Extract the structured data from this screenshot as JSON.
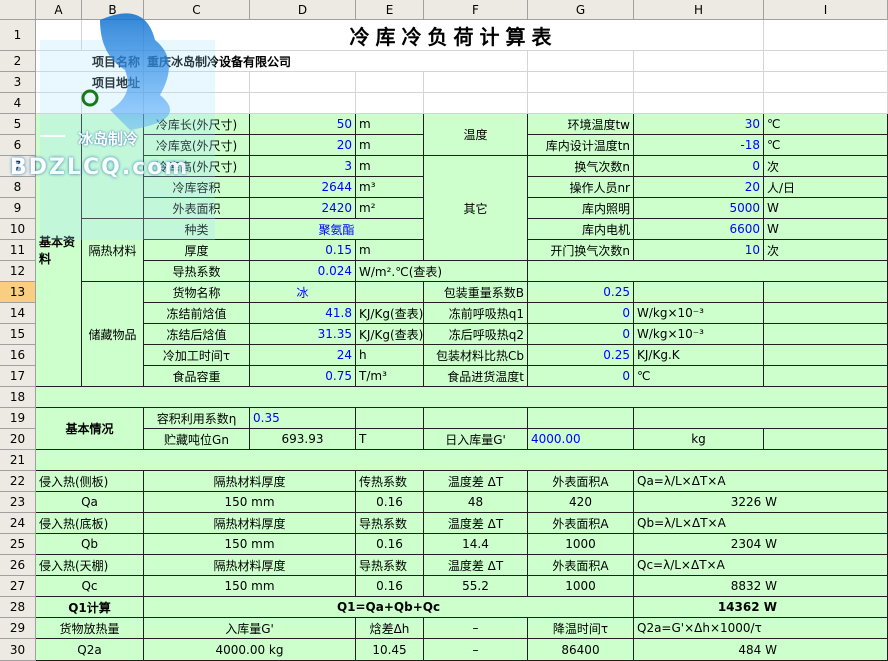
{
  "columns": [
    "A",
    "B",
    "C",
    "D",
    "E",
    "F",
    "G",
    "H",
    "I"
  ],
  "rows": [
    "1",
    "2",
    "3",
    "4",
    "5",
    "6",
    "7",
    "8",
    "9",
    "10",
    "11",
    "12",
    "13",
    "14",
    "15",
    "16",
    "17",
    "18",
    "19",
    "20",
    "21",
    "22",
    "23",
    "24",
    "25",
    "26",
    "27",
    "28",
    "29",
    "30"
  ],
  "selected_row": "13",
  "watermark": {
    "brand_cn": "冰岛制冷",
    "brand_url": "BDZLCQ.com"
  },
  "title": "冷库冷负荷计算表",
  "r2": {
    "label": "项目名称",
    "company": "重庆冰岛制冷设备有限公司"
  },
  "r3": {
    "label": "项目地址"
  },
  "basic_label": "基本资料",
  "insul_label": "隔热材料",
  "storage_label": "储藏物品",
  "left": [
    {
      "row": "5",
      "label": "冷库长(外尺寸)",
      "value": "50",
      "unit": "m"
    },
    {
      "row": "6",
      "label": "冷库宽(外尺寸)",
      "value": "20",
      "unit": "m"
    },
    {
      "row": "7",
      "label": "冷库高(外尺寸)",
      "value": "3",
      "unit": "m"
    },
    {
      "row": "8",
      "label": "冷库容积",
      "value": "2644",
      "unit": "m³"
    },
    {
      "row": "9",
      "label": "外表面积",
      "value": "2420",
      "unit": "m²"
    }
  ],
  "r10": {
    "label": "种类",
    "value": "聚氨酯"
  },
  "r11": {
    "label": "厚度",
    "value": "0.15",
    "unit": "m"
  },
  "r12": {
    "label": "导热系数",
    "value": "0.024",
    "unit": "W/m².℃(查表)"
  },
  "temp_label": "温度",
  "other_label": "其它",
  "right": [
    {
      "label": "环境温度tw",
      "value": "30",
      "unit": "℃"
    },
    {
      "label": "库内设计温度tn",
      "value": "-18",
      "unit": "℃"
    },
    {
      "label": "换气次数n",
      "value": "0",
      "unit": "次"
    },
    {
      "label": "操作人员nr",
      "value": "20",
      "unit": "人/日"
    },
    {
      "label": "库内照明",
      "value": "5000",
      "unit": "W"
    },
    {
      "label": "库内电机",
      "value": "6600",
      "unit": "W"
    },
    {
      "label": "开门换气次数n",
      "value": "10",
      "unit": "次"
    }
  ],
  "storage": [
    {
      "label": "货物名称",
      "value": "冰",
      "unit": "",
      "rlabel": "包装重量系数B",
      "rvalue": "0.25",
      "runit": ""
    },
    {
      "label": "冻结前焓值",
      "value": "41.8",
      "unit": "KJ/Kg(查表)",
      "rlabel": "冻前呼吸热q1",
      "rvalue": "0",
      "runit": "W/kg×10⁻³"
    },
    {
      "label": "冻结后焓值",
      "value": "31.35",
      "unit": "KJ/Kg(查表)",
      "rlabel": "冻后呼吸热q2",
      "rvalue": "0",
      "runit": "W/kg×10⁻³"
    },
    {
      "label": "冷加工时间τ",
      "value": "24",
      "unit": "h",
      "rlabel": "包装材料比热Cb",
      "rvalue": "0.25",
      "runit": "KJ/Kg.K"
    },
    {
      "label": "食品容重",
      "value": "0.75",
      "unit": "T/m³",
      "rlabel": "食品进货温度t",
      "rvalue": "0",
      "runit": "℃"
    }
  ],
  "basic_info": {
    "label": "基本情况",
    "vol_label": "容积利用系数η",
    "vol_value": "0.35",
    "ton_label": "贮藏吨位Gn",
    "ton_value": "693.93",
    "ton_unit": "T",
    "daily_label": "日入库量G'",
    "daily_value": "4000.00",
    "daily_unit": "kg"
  },
  "heat_rows": [
    {
      "row": "22",
      "a": "侵入热(侧板)",
      "c": "隔热材料厚度",
      "e": "传热系数",
      "f": "温度差 ΔT",
      "g": "外表面积A",
      "h": "Qa=λ/L×ΔT×A",
      "bold": false
    },
    {
      "row": "23",
      "a": "Qa",
      "c": "150 mm",
      "e": "0.16",
      "f": "48",
      "g": "420",
      "h": "3226 W",
      "bold": false
    },
    {
      "row": "24",
      "a": "侵入热(底板)",
      "c": "隔热材料厚度",
      "e": "导热系数",
      "f": "温度差 ΔT",
      "g": "外表面积A",
      "h": "Qb=λ/L×ΔT×A",
      "bold": false
    },
    {
      "row": "25",
      "a": "Qb",
      "c": "150 mm",
      "e": "0.16",
      "f": "14.4",
      "g": "1000",
      "h": "2304 W",
      "bold": false
    },
    {
      "row": "26",
      "a": "侵入热(天棚)",
      "c": "隔热材料厚度",
      "e": "导热系数",
      "f": "温度差 ΔT",
      "g": "外表面积A",
      "h": "Qc=λ/L×ΔT×A",
      "bold": false
    },
    {
      "row": "27",
      "a": "Qc",
      "c": "150 mm",
      "e": "0.16",
      "f": "55.2",
      "g": "1000",
      "h": "8832 W",
      "bold": false
    }
  ],
  "q1": {
    "label": "Q1计算",
    "formula": "Q1=Qa+Qb+Qc",
    "value": "14362 W"
  },
  "r29": {
    "a": "货物放热量",
    "c": "入库量G'",
    "e": "焓差Δh",
    "f": "–",
    "g": "降温时间τ",
    "h": "Q2a=G'×Δh×1000/τ"
  },
  "r30": {
    "a": "Q2a",
    "c": "4000.00 kg",
    "e": "10.45",
    "f": "–",
    "g": "86400",
    "h": "484 W"
  }
}
